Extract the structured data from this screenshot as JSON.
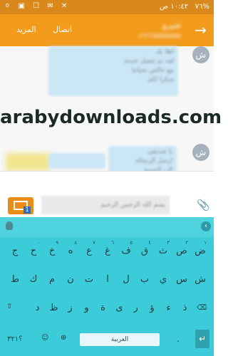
{
  "status_bar": {
    "time": "١٠:٤٢ ص",
    "battery": "%٧٦"
  },
  "header": {
    "contact_name": "شيرو",
    "contact_number": "+٩٦٦٥٥٥٥٥٥٥٥",
    "call_label": "اتصال",
    "more_label": "المزيد"
  },
  "messages": [
    {
      "sender_initial": "ش",
      "lines": [
        "اهلا بك",
        "لقد تم تفعيل خدمة",
        "مع خالص تحياتنا",
        "شكرا لكم"
      ]
    },
    {
      "sender_initial": "ش",
      "lines": [
        "يا صديقي",
        "ارسل الرسالة",
        "الى الجميع"
      ]
    }
  ],
  "watermark": "arabydownloads.com",
  "compose": {
    "placeholder": "بسم الله الرحمن الرحيم",
    "sim_number": "1"
  },
  "keyboard": {
    "row1": [
      "ض",
      "ص",
      "ث",
      "ق",
      "ف",
      "غ",
      "ع",
      "ه",
      "خ",
      "ح",
      "ج"
    ],
    "row1_numbers": [
      "١",
      "٢",
      "٣",
      "٤",
      "٥",
      "٦",
      "٧",
      "٨",
      "٩",
      "٠"
    ],
    "row2": [
      "ش",
      "س",
      "ي",
      "ب",
      "ل",
      "ا",
      "ت",
      "ن",
      "م",
      "ك",
      "ط"
    ],
    "row3": [
      "ذ",
      "ء",
      "ؤ",
      "ر",
      "ى",
      "ة",
      "و",
      "ز",
      "ظ",
      "د"
    ],
    "row4_right_letter": "ظ",
    "mode_label": "؟٣٢١",
    "space_label": "العربية"
  }
}
